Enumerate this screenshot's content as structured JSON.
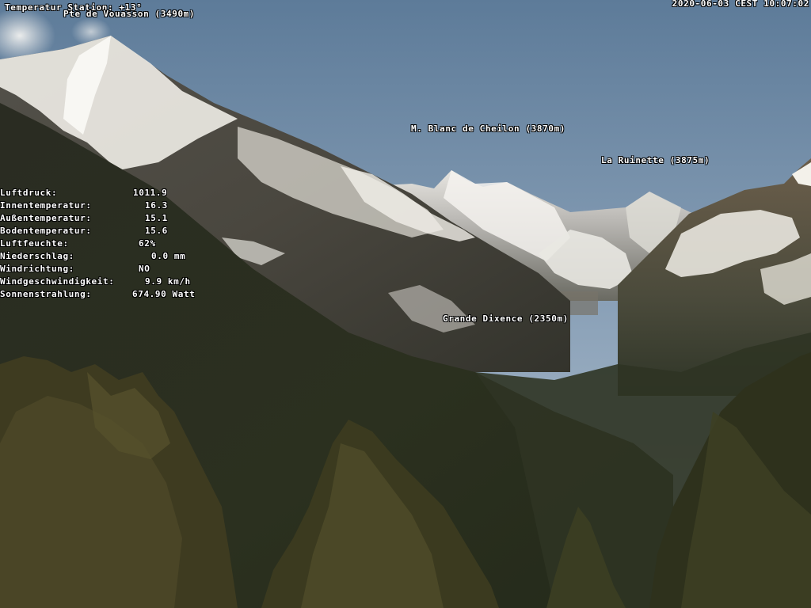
{
  "station": {
    "temperature_label": "Temperatur Station: +13°",
    "timestamp": "2020-06-03 CEST 10:07:02"
  },
  "peaks": [
    {
      "name": "Pte de Vouasson (3490m)"
    },
    {
      "name": "M. Blanc de Cheilon (3870m)"
    },
    {
      "name": "La Ruinette (3875m)"
    },
    {
      "name": "Grande Dixence (2350m)"
    }
  ],
  "weather": [
    {
      "label": "Luftdruck:",
      "value": "1011.9"
    },
    {
      "label": "Innentemperatur:",
      "value": "16.3"
    },
    {
      "label": "Außentemperatur:",
      "value": "15.1"
    },
    {
      "label": "Bodentemperatur:",
      "value": "15.6"
    },
    {
      "label": "Luftfeuchte:",
      "value": "62%"
    },
    {
      "label": "Niederschlag:",
      "value": "0.0 mm"
    },
    {
      "label": "Windrichtung:",
      "value": "NO"
    },
    {
      "label": "Windgeschwindigkeit:",
      "value": "9.9 km/h"
    },
    {
      "label": "Sonnenstrahlung:",
      "value": "674.90 Watt"
    }
  ],
  "colors": {
    "sky_top": "#6d8aa6",
    "sky_bottom": "#a9b9c9",
    "snow": "#f3f1ec",
    "rock_dark": "#3a3a36",
    "forest": "#2c3320",
    "tree_foreground": "#3f3a1f"
  }
}
